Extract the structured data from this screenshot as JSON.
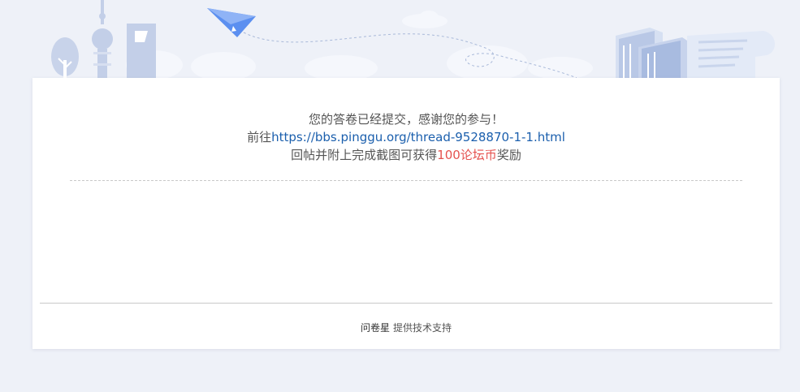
{
  "message": {
    "line1": "您的答卷已经提交，感谢您的参与！",
    "line2_prefix": "前往",
    "line2_link": "https://bbs.pinggu.org/thread-9528870-1-1.html",
    "line3_prefix": "回帖并附上完成截图可获得",
    "line3_reward": "100论坛币",
    "line3_suffix": "奖励"
  },
  "footer": {
    "brand": "问卷星",
    "support": "提供技术支持"
  },
  "colors": {
    "link": "#1b5fad",
    "reward": "#e5524f",
    "background": "#eef1f8",
    "illustration": "#b9c8e6",
    "paper_plane": "#5b8ff0"
  },
  "icons": [
    "tree-icon",
    "tv-tower-icon",
    "skyscraper-icon",
    "paper-plane-icon",
    "cloud-icon",
    "books-icon",
    "scroll-icon"
  ]
}
